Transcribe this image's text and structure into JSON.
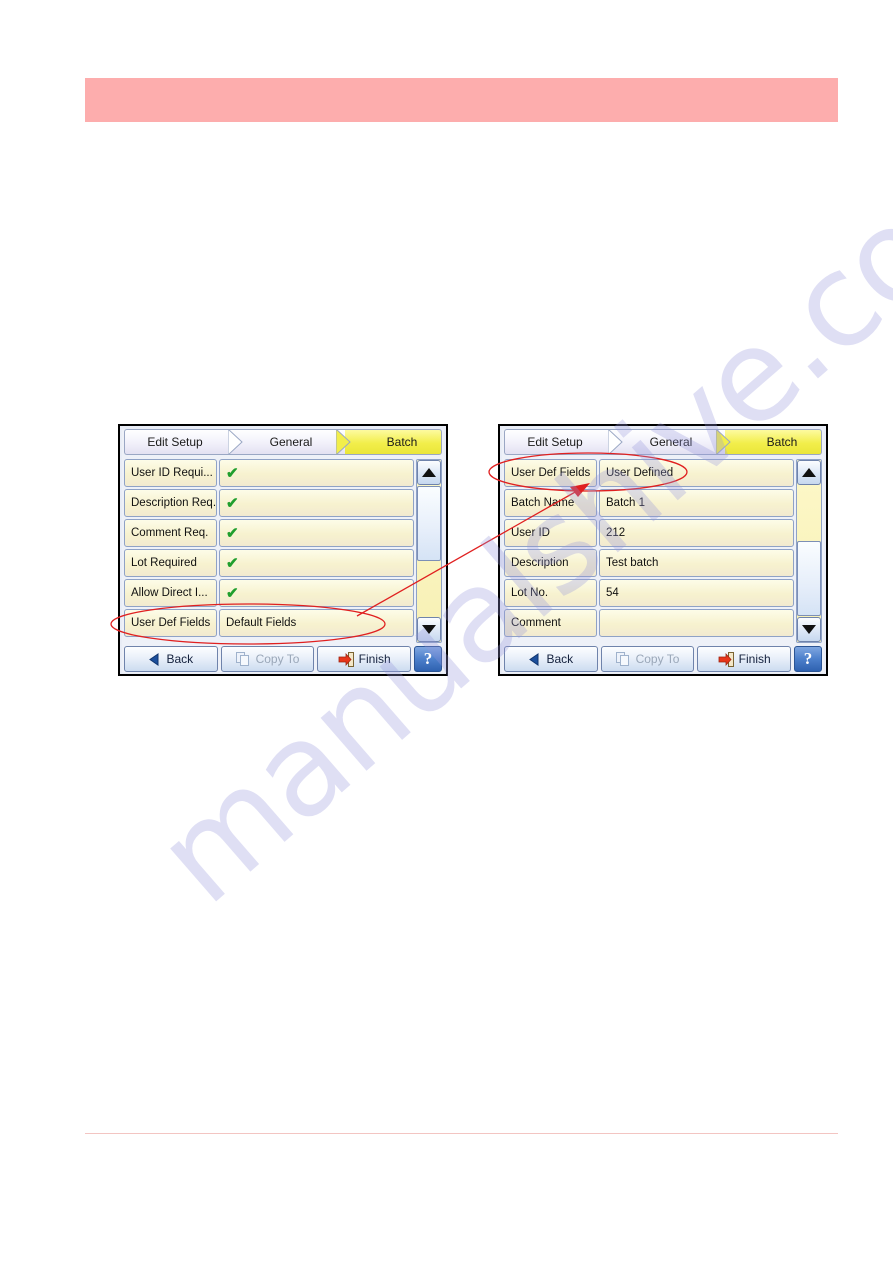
{
  "page": {
    "banner_text": "",
    "watermark": "manualshive.com"
  },
  "screens": [
    {
      "id": "left",
      "tabs": [
        {
          "label": "Edit Setup",
          "active": false
        },
        {
          "label": "General",
          "active": false
        },
        {
          "label": "Batch",
          "active": true
        }
      ],
      "rows": [
        {
          "label": "User ID Requi...",
          "value": "",
          "check": "✔"
        },
        {
          "label": "Description Req.",
          "value": "",
          "check": "✔"
        },
        {
          "label": "Comment Req.",
          "value": "",
          "check": "✔"
        },
        {
          "label": "Lot Required",
          "value": "",
          "check": "✔"
        },
        {
          "label": "Allow Direct I...",
          "value": "",
          "check": "✔"
        },
        {
          "label": "User Def Fields",
          "value": "Default Fields",
          "check": ""
        }
      ],
      "scrollbar": {
        "up": "▲",
        "down": "▼",
        "thumb_position": "top"
      },
      "buttons": {
        "back": "Back",
        "copy_to": "Copy To",
        "finish": "Finish",
        "help": "?"
      }
    },
    {
      "id": "right",
      "tabs": [
        {
          "label": "Edit Setup",
          "active": false
        },
        {
          "label": "General",
          "active": false
        },
        {
          "label": "Batch",
          "active": true
        }
      ],
      "rows": [
        {
          "label": "User Def Fields",
          "value": "User Defined",
          "check": ""
        },
        {
          "label": "Batch Name",
          "value": "Batch 1",
          "check": ""
        },
        {
          "label": "User ID",
          "value": "212",
          "check": ""
        },
        {
          "label": "Description",
          "value": "Test batch",
          "check": ""
        },
        {
          "label": "Lot No.",
          "value": "54",
          "check": ""
        },
        {
          "label": "Comment",
          "value": "",
          "check": ""
        }
      ],
      "scrollbar": {
        "up": "▲",
        "down": "▼",
        "thumb_position": "bottom"
      },
      "buttons": {
        "back": "Back",
        "copy_to": "Copy To",
        "finish": "Finish",
        "help": "?"
      }
    }
  ],
  "annotations": {
    "highlight_color": "#e02020",
    "left_ellipse_target": "User Def Fields / Default Fields",
    "right_ellipse_target": "User Def Fields / User Defined",
    "arrow_note": "points from left User Def Fields row to right User Defined value"
  }
}
